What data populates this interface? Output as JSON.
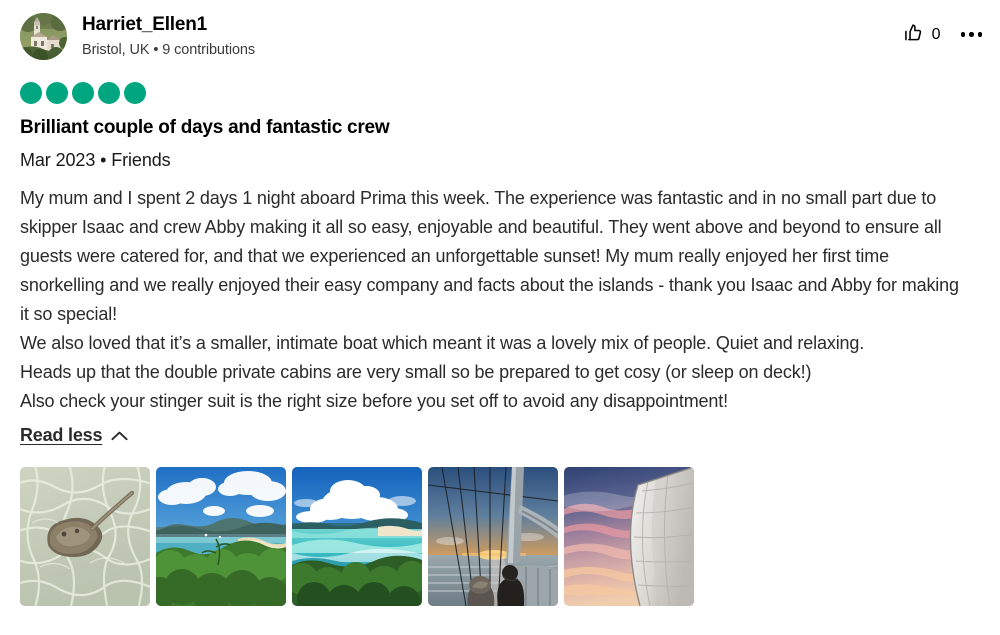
{
  "review": {
    "author": {
      "username": "Harriet_Ellen1",
      "meta": "Bristol, UK • 9 contributions",
      "avatar_alt": "hillside-church-photo"
    },
    "actions": {
      "helpful_icon": "thumbs-up-icon",
      "helpful_count": "0",
      "more_icon": "ellipsis-icon"
    },
    "rating": {
      "value": 5,
      "max": 5,
      "bubble_color": "#00a680",
      "icon": "bubble-rating-icon"
    },
    "title": "Brilliant couple of days and fantastic crew",
    "subtitle": "Mar 2023 • Friends",
    "body": "My mum and I spent 2 days 1 night aboard Prima this week. The experience was fantastic and in no small part due to skipper Isaac and crew Abby making it all so easy, enjoyable and beautiful. They went above and beyond to ensure all guests were catered for, and that we experienced an unforgettable sunset! My mum really enjoyed her first time snorkelling and we really enjoyed their easy company and facts about the islands - thank you Isaac and Abby for making it so special!\nWe also loved that it’s a smaller, intimate boat which meant it was a lovely mix of people. Quiet and relaxing.\nHeads up that the double private cabins are very small so be prepared to get cosy (or sleep on deck!)\nAlso check your stinger suit is the right size before you set off to avoid any disappointment!",
    "read_toggle": {
      "label": "Read less",
      "icon": "chevron-up-icon"
    },
    "photos": [
      {
        "alt": "stingray-in-clear-shallow-water"
      },
      {
        "alt": "tropical-bay-with-green-foliage"
      },
      {
        "alt": "turquoise-lagoon-whitehaven-beach"
      },
      {
        "alt": "sunset-from-sailboat-deck"
      },
      {
        "alt": "pink-sunset-sky-with-sail"
      }
    ]
  }
}
